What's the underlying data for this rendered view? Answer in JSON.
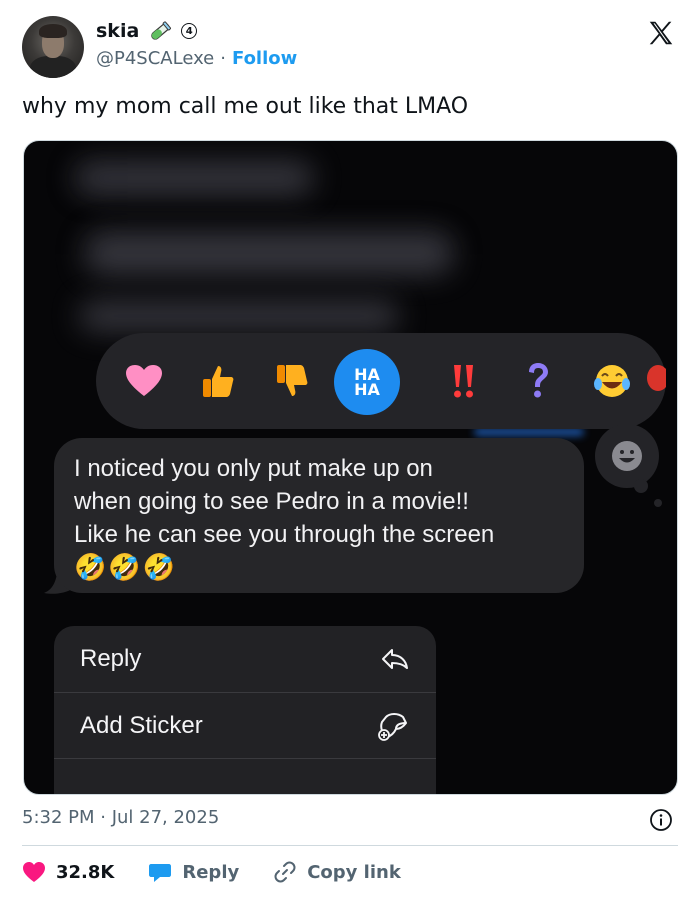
{
  "author": {
    "name": "skia",
    "badge_number": "4",
    "handle": "@P4SCALexe",
    "separator": "·",
    "follow_label": "Follow"
  },
  "tweet": {
    "text": "why my mom call me out like that LMAO",
    "timestamp": "5:32 PM · Jul 27, 2025"
  },
  "screenshot": {
    "reactions": [
      "heart-emoji",
      "thumbs-up-emoji",
      "thumbs-down-emoji",
      "haha-emoji",
      "double-exclamation-emoji",
      "question-emoji",
      "tears-of-joy-emoji",
      "balloon-emoji"
    ],
    "haha_label_top": "HA",
    "haha_label_bottom": "HA",
    "message_lines": [
      "I noticed you only put make up on",
      "when going to see Pedro in a movie!!",
      "Like he can see you through the screen"
    ],
    "message_emojis": "🤣🤣🤣",
    "menu": [
      {
        "label": "Reply",
        "icon": "reply-arrow-icon"
      },
      {
        "label": "Add Sticker",
        "icon": "add-sticker-icon"
      }
    ]
  },
  "engagement": {
    "likes": "32.8K",
    "reply_label": "Reply",
    "copy_link_label": "Copy link"
  },
  "colors": {
    "link_blue": "#1d9bf0",
    "like_pink": "#f91880",
    "muted": "#536471"
  }
}
